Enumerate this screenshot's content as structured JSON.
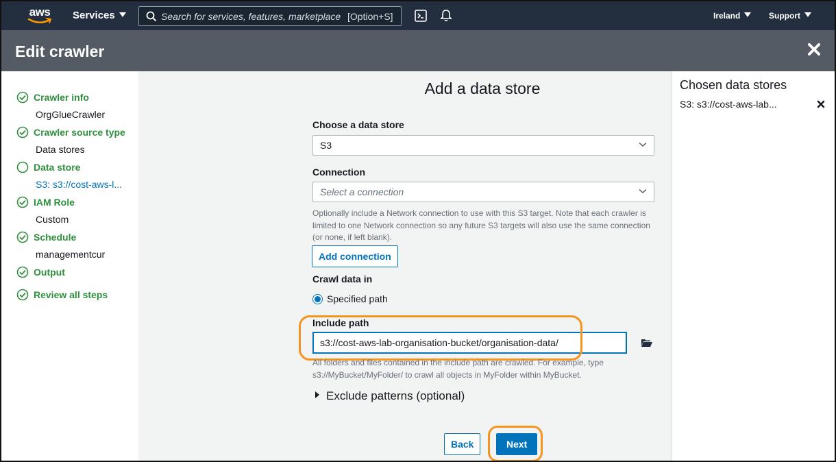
{
  "topnav": {
    "logo_text": "aws",
    "services_label": "Services",
    "search_placeholder": "Search for services, features, marketplace products, and docs",
    "search_shortcut": "[Option+S]",
    "region_label": "Ireland",
    "support_label": "Support"
  },
  "header": {
    "title": "Edit crawler"
  },
  "steps": [
    {
      "label": "Crawler info",
      "value": "OrgGlueCrawler",
      "status": "complete"
    },
    {
      "label": "Crawler source type",
      "value": "Data stores",
      "status": "complete"
    },
    {
      "label": "Data store",
      "value": "S3: s3://cost-aws-l...",
      "status": "current"
    },
    {
      "label": "IAM Role",
      "value": "Custom",
      "status": "complete"
    },
    {
      "label": "Schedule",
      "value": "managementcur",
      "status": "complete"
    },
    {
      "label": "Output",
      "value": "",
      "status": "complete"
    },
    {
      "label": "Review all steps",
      "value": "",
      "status": "complete"
    }
  ],
  "main": {
    "title": "Add a data store",
    "data_store": {
      "label": "Choose a data store",
      "value": "S3"
    },
    "connection": {
      "label": "Connection",
      "placeholder": "Select a connection",
      "help_line1": "Optionally include a Network connection to use with this S3 target. Note that each crawler is",
      "help_line2": "limited to one Network connection so any future S3 targets will also use the same connection",
      "help_line3": "(or none, if left blank).",
      "add_button": "Add connection"
    },
    "crawl_data_in": {
      "label": "Crawl data in",
      "option": "Specified path"
    },
    "include_path": {
      "label": "Include path",
      "value": "s3://cost-aws-lab-organisation-bucket/organisation-data/",
      "help_line1": "All folders and files contained in the include path are crawled. For example, type",
      "help_line2": "s3://MyBucket/MyFolder/ to crawl all objects in MyFolder within MyBucket."
    },
    "exclude_patterns_label": "Exclude patterns (optional)",
    "back_button": "Back",
    "next_button": "Next"
  },
  "right_panel": {
    "title": "Chosen data stores",
    "items": [
      "S3: s3://cost-aws-lab..."
    ]
  },
  "colors": {
    "nav_bg": "#232f3e",
    "header_bg": "#545b64",
    "step_complete": "#2e8f3c",
    "link": "#0073bb",
    "highlight": "#f5941e"
  }
}
